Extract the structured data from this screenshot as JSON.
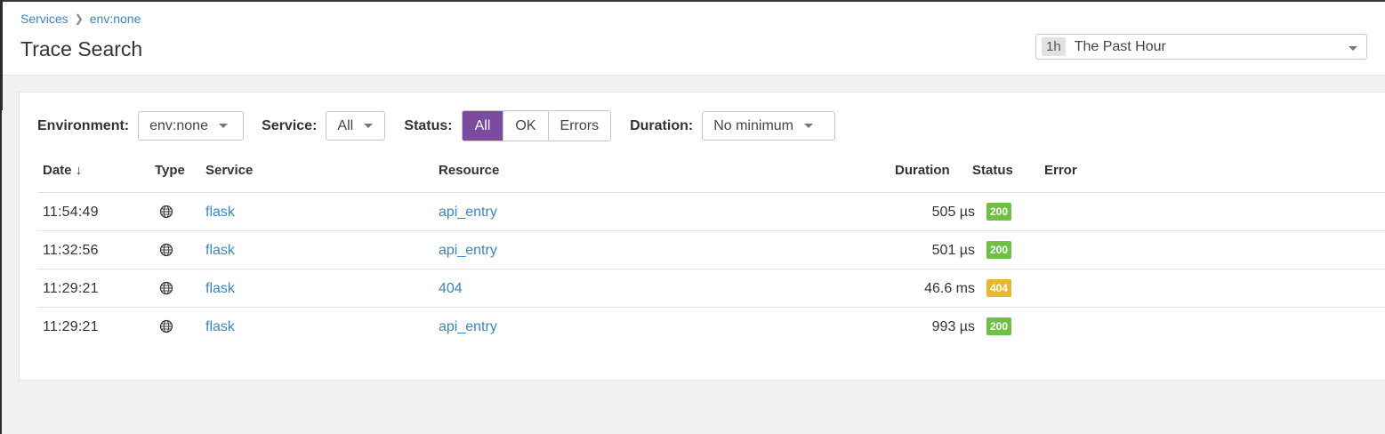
{
  "breadcrumb": {
    "root": "Services",
    "current": "env:none"
  },
  "page": {
    "title": "Trace Search"
  },
  "time_picker": {
    "badge": "1h",
    "label": "The Past Hour"
  },
  "filters": {
    "environment": {
      "label": "Environment:",
      "value": "env:none"
    },
    "service": {
      "label": "Service:",
      "value": "All"
    },
    "status": {
      "label": "Status:",
      "options": [
        "All",
        "OK",
        "Errors"
      ],
      "selected": "All"
    },
    "duration": {
      "label": "Duration:",
      "value": "No minimum"
    }
  },
  "table": {
    "columns": {
      "date": "Date ↓",
      "type": "Type",
      "service": "Service",
      "resource": "Resource",
      "duration": "Duration",
      "status": "Status",
      "error": "Error"
    },
    "rows": [
      {
        "date": "11:54:49",
        "type": "web-globe-icon",
        "service": "flask",
        "resource": "api_entry",
        "duration": "505 µs",
        "status": "200"
      },
      {
        "date": "11:32:56",
        "type": "web-globe-icon",
        "service": "flask",
        "resource": "api_entry",
        "duration": "501 µs",
        "status": "200"
      },
      {
        "date": "11:29:21",
        "type": "web-globe-icon",
        "service": "flask",
        "resource": "404",
        "duration": "46.6 ms",
        "status": "404"
      },
      {
        "date": "11:29:21",
        "type": "web-globe-icon",
        "service": "flask",
        "resource": "api_entry",
        "duration": "993 µs",
        "status": "200"
      }
    ]
  },
  "colors": {
    "accent": "#7a4ba0",
    "link": "#3a86c0",
    "status_ok": "#6fbf45",
    "status_warn": "#e8b731"
  }
}
